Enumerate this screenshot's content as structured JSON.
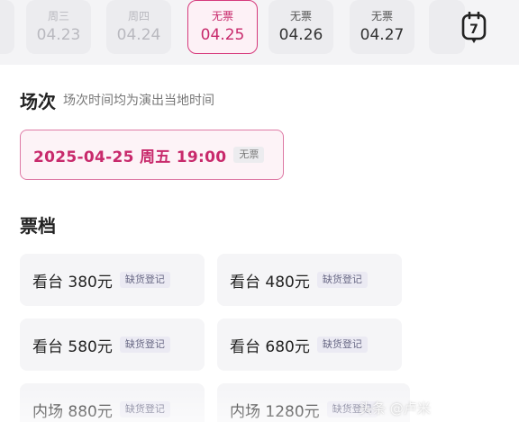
{
  "dates": [
    {
      "weekday": "周三",
      "date": "04.23",
      "state": "disabled"
    },
    {
      "weekday": "周四",
      "date": "04.24",
      "state": "disabled"
    },
    {
      "weekday": "无票",
      "date": "04.25",
      "state": "selected"
    },
    {
      "weekday": "无票",
      "date": "04.26",
      "state": "normal"
    },
    {
      "weekday": "无票",
      "date": "04.27",
      "state": "normal"
    }
  ],
  "calendar_icon_day": "7",
  "session": {
    "title": "场次",
    "subtitle": "场次时间均为演出当地时间",
    "datetime": "2025-04-25 周五 19:00",
    "tag": "无票"
  },
  "tiers": {
    "title": "票档",
    "status_tag": "缺货登记",
    "items": [
      {
        "label": "看台 380元",
        "tag": "缺货登记"
      },
      {
        "label": "看台 480元",
        "tag": "缺货登记"
      },
      {
        "label": "看台 580元",
        "tag": "缺货登记"
      },
      {
        "label": "看台 680元",
        "tag": "缺货登记"
      },
      {
        "label": "内场 880元",
        "tag": "缺货登记"
      },
      {
        "label": "内场 1280元",
        "tag": "缺货登记"
      }
    ]
  },
  "watermark": "头条 @卢米"
}
